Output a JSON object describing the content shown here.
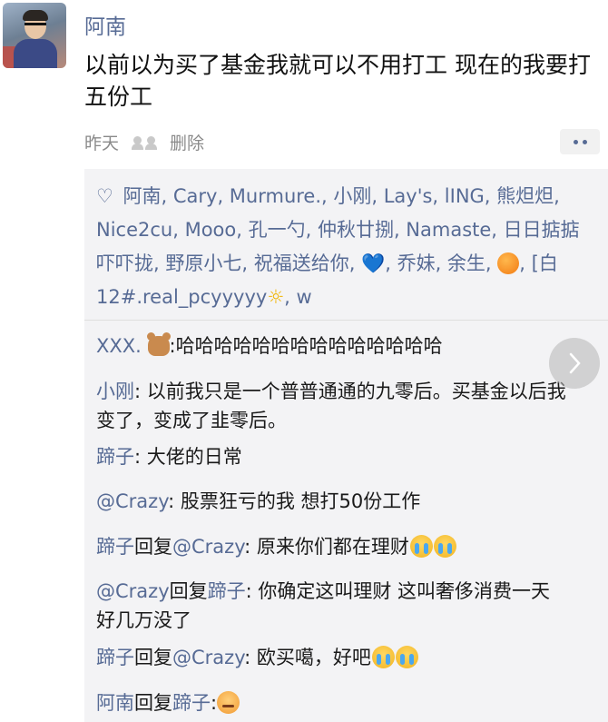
{
  "post": {
    "author": "阿南",
    "text": "以前以为买了基金我就可以不用打工 现在的我要打五份工",
    "time": "昨天",
    "delete_label": "删除"
  },
  "likes": {
    "heart_icon": "♡",
    "names_part1": " 阿南, Cary, Murmure., 小刚, Lay's, lING, 熊炟炟, Nice2cu, Mooo, 孔一勺, 仲秋廿捌, Namaste, 日日掂掂吓吓拢, 野原小七, 祝福送给你, ",
    "heart_emoji": "💙",
    "names_part2": ", 乔妹, 余生, ",
    "names_part3": ", [白12#.real_pcyyyyy",
    "sun_emoji": "☼",
    "names_part4": ", w"
  },
  "comments": [
    {
      "name": "XXX.",
      "text": ":哈哈哈哈哈哈哈哈哈哈哈哈哈哈"
    },
    {
      "name": "小刚",
      "text": ": 以前我只是一个普普通通的九零后。买基金以后我变了，变成了韭零后。"
    },
    {
      "name": "蹄子",
      "text": ": 大佬的日常"
    },
    {
      "name": "@Crazy",
      "text": ": 股票狂亏的我  想打50份工作"
    },
    {
      "name": "蹄子",
      "reply_word": "回复",
      "target": "@Crazy",
      "text": ": 原来你们都在理财"
    },
    {
      "name": "@Crazy",
      "reply_word": "回复",
      "target": "蹄子",
      "text": ": 你确定这叫理财 这叫奢侈消费一天好几万没了"
    },
    {
      "name": "蹄子",
      "reply_word": "回复",
      "target": "@Crazy",
      "text": ": 欧买噶，好吧"
    },
    {
      "name": "阿南",
      "reply_word": "回复",
      "target": "蹄子",
      "text": ":"
    }
  ],
  "colors": {
    "link": "#576b95",
    "panel": "#f3f3f5"
  }
}
